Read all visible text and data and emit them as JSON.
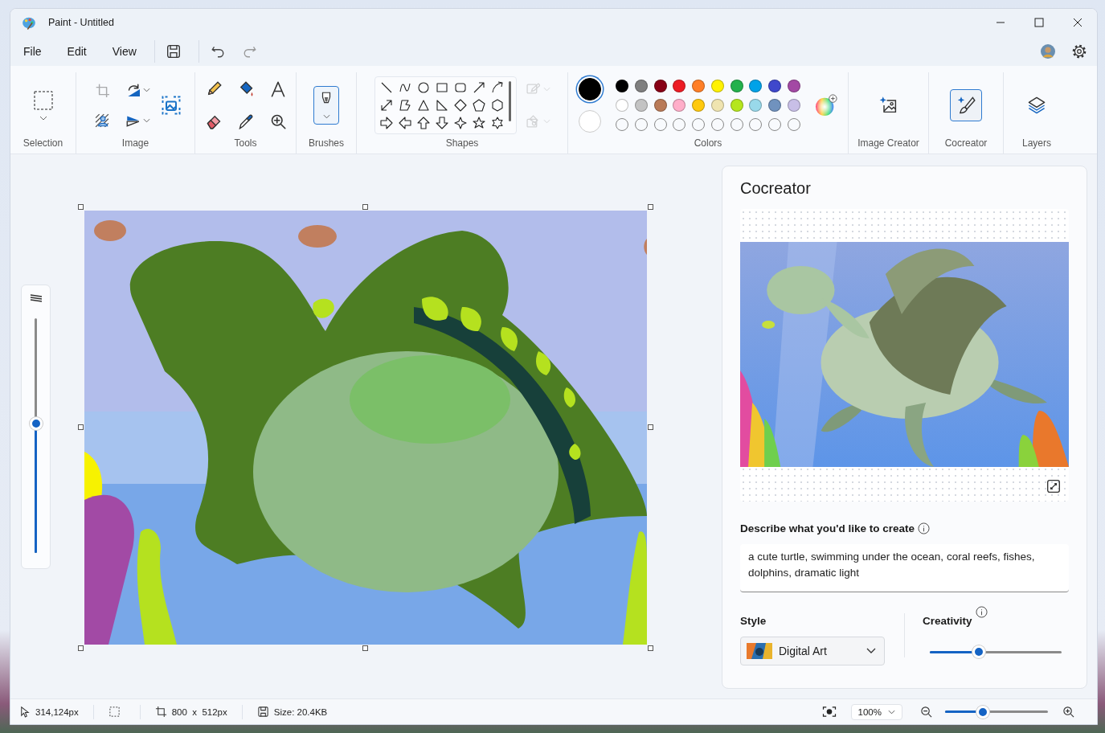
{
  "window": {
    "title": "Paint - Untitled"
  },
  "menu": [
    {
      "label": "File"
    },
    {
      "label": "Edit"
    },
    {
      "label": "View"
    }
  ],
  "ribbon": {
    "selection": {
      "label": "Selection"
    },
    "image": {
      "label": "Image",
      "tools": [
        {
          "kind": "crop",
          "disabled": true
        },
        {
          "kind": "rotate",
          "disabled": false
        },
        {
          "kind": "background",
          "disabled": false
        },
        {
          "kind": "flip",
          "disabled": false
        },
        {
          "kind": "resize",
          "disabled": false
        }
      ]
    },
    "tools": {
      "label": "Tools",
      "items": [
        {
          "kind": "pencil"
        },
        {
          "kind": "fill"
        },
        {
          "kind": "text"
        },
        {
          "kind": "eraser"
        },
        {
          "kind": "picker"
        },
        {
          "kind": "magnifier"
        }
      ]
    },
    "brushes": {
      "label": "Brushes",
      "selected": true
    },
    "shapes": {
      "label": "Shapes",
      "styles": [
        {
          "kind": "outline",
          "disabled": true
        },
        {
          "kind": "fill",
          "disabled": true
        }
      ]
    },
    "colors": {
      "label": "Colors",
      "current": [
        {
          "color": "#000000",
          "selected": true
        },
        {
          "color": "#ffffff",
          "selected": false
        }
      ],
      "palette": [
        {
          "color": "#000000"
        },
        {
          "color": "#7f7f7f"
        },
        {
          "color": "#880015"
        },
        {
          "color": "#ed1c24"
        },
        {
          "color": "#ff7f27"
        },
        {
          "color": "#fff200"
        },
        {
          "color": "#22b14c"
        },
        {
          "color": "#00a2e8"
        },
        {
          "color": "#3f48cc"
        },
        {
          "color": "#a349a4"
        },
        {
          "color": "#ffffff"
        },
        {
          "color": "#c3c3c3"
        },
        {
          "color": "#b97a57"
        },
        {
          "color": "#ffaec9"
        },
        {
          "color": "#ffc90e"
        },
        {
          "color": "#efe4b0"
        },
        {
          "color": "#b5e61d"
        },
        {
          "color": "#99d9ea"
        },
        {
          "color": "#7092be"
        },
        {
          "color": "#c8bfe7"
        }
      ],
      "custom": [
        {
          "filled": false
        },
        {
          "filled": false
        },
        {
          "filled": false
        },
        {
          "filled": false
        },
        {
          "filled": false
        },
        {
          "filled": false
        },
        {
          "filled": false
        },
        {
          "filled": false
        },
        {
          "filled": false
        },
        {
          "filled": false
        }
      ]
    },
    "actions": [
      {
        "kind": "image-creator",
        "label": "Image Creator",
        "selected": false
      },
      {
        "kind": "cocreator",
        "label": "Cocreator",
        "selected": true
      },
      {
        "kind": "layers",
        "label": "Layers",
        "selected": false
      }
    ]
  },
  "side_zoom": {
    "level": 0.55
  },
  "cocreator": {
    "title": "Cocreator",
    "prompt_label": "Describe what you'd like to create",
    "prompt": "a cute turtle, swimming under the ocean, coral reefs, fishes, dolphins, dramatic light",
    "style_label": "Style",
    "style": "Digital Art",
    "creativity_label": "Creativity",
    "creativity": {
      "level": 0.37
    }
  },
  "status_bar": {
    "cursor": "314,124px",
    "canvas_size": "800  x  512px",
    "file_size": "Size: 20.4KB",
    "zoom": "100%",
    "zoom_slider": {
      "level": 0.37
    }
  }
}
